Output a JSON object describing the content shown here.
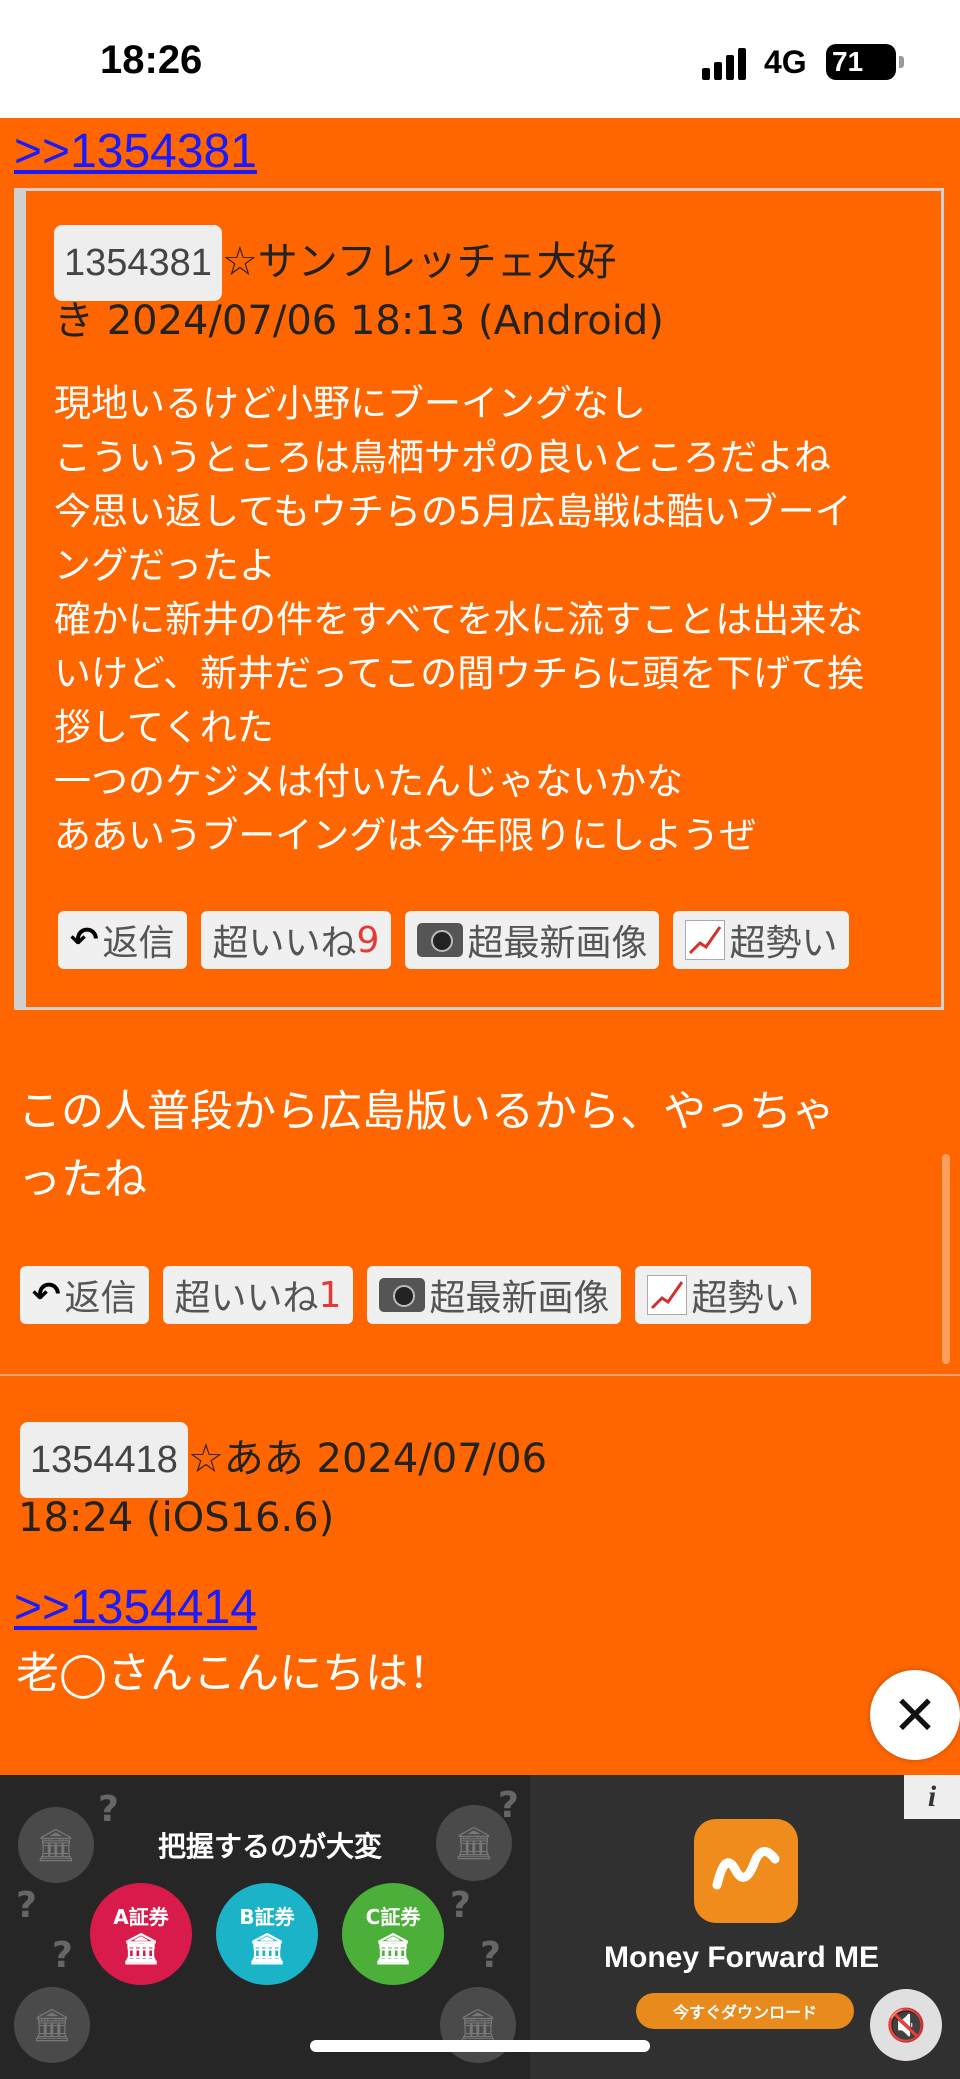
{
  "status_bar": {
    "time": "18:26",
    "network": "4G",
    "battery": "71"
  },
  "quote_link": ">>1354381",
  "quoted_post": {
    "id": "1354381",
    "header_line1": "☆サンフレッチェ大好",
    "header_line2": "き 2024/07/06 18:13 (Android)",
    "body_lines": [
      "現地いるけど小野にブーイングなし",
      "こういうところは鳥栖サポの良いところだよね",
      "今思い返してもウチらの5月広島戦は酷いブーイ",
      "ングだったよ",
      "確かに新井の件をすべてを水に流すことは出来な",
      "いけど、新井だってこの間ウチらに頭を下げて挨",
      "拶してくれた",
      "一つのケジメは付いたんじゃないかな",
      "ああいうブーイングは今年限りにしようぜ"
    ],
    "actions": {
      "reply": "返信",
      "like": "超いいね",
      "like_count": "9",
      "images": "超最新画像",
      "trend": "超勢い"
    }
  },
  "reply_post": {
    "text_line1": "この人普段から広島版いるから、やっちゃ",
    "text_line2": "ったね",
    "actions": {
      "reply": "返信",
      "like": "超いいね",
      "like_count": "1",
      "images": "超最新画像",
      "trend": "超勢い"
    }
  },
  "next_post": {
    "id": "1354418",
    "header_line1": "☆ああ 2024/07/06",
    "header_line2": "18:24 (iOS16.6)",
    "quote_link": ">>1354414",
    "text": "老◯さんこんにちは！"
  },
  "close_button": "✕",
  "ad": {
    "title": "把握するのが大変",
    "banks": [
      {
        "label": "A証券",
        "color": "#d81b4a"
      },
      {
        "label": "B証券",
        "color": "#1ab3c8"
      },
      {
        "label": "C証券",
        "color": "#4caf3a"
      }
    ],
    "brand": "Money Forward ME",
    "cta": "今すぐダウンロード",
    "info": "i"
  }
}
